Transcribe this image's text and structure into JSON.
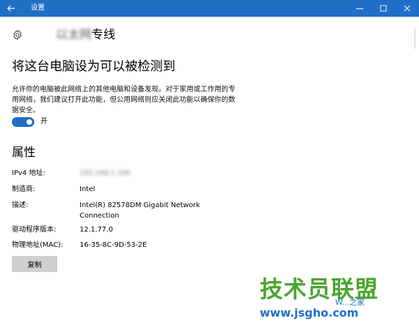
{
  "window": {
    "title": "设置"
  },
  "header": {
    "title": "以太网专线",
    "title_visible_part": "专线"
  },
  "discoverable": {
    "heading": "将这台电脑设为可以被检测到",
    "description": "允许你的电脑被此网络上的其他电脑和设备发现。对于家用或工作用的专用网络，我们建议打开此功能，但公用网络则应关闭此功能以确保你的数据安全。",
    "toggle_state": "开",
    "toggle_on": true
  },
  "properties": {
    "heading": "属性",
    "items": [
      {
        "label": "IPv4 地址:",
        "value": "192.168.1.100",
        "blurred": true
      },
      {
        "label": "制造商:",
        "value": "Intel"
      },
      {
        "label": "描述:",
        "value": "Intel(R) 82578DM Gigabit Network Connection"
      },
      {
        "label": "驱动程序版本:",
        "value": "12.1.77.0"
      },
      {
        "label": "物理地址(MAC):",
        "value": "16-35-8C-9D-53-2E"
      }
    ],
    "copy_button": "复制"
  },
  "watermark": {
    "main": "技术员联盟",
    "url": "www.jsgho.com",
    "tag": "W...之家"
  },
  "colors": {
    "accent": "#1f6fc5",
    "button_bg": "#cfcfcf",
    "watermark_green": "#4aa52e"
  },
  "icons": {
    "back": "back-arrow-icon",
    "settings": "gear-icon"
  }
}
